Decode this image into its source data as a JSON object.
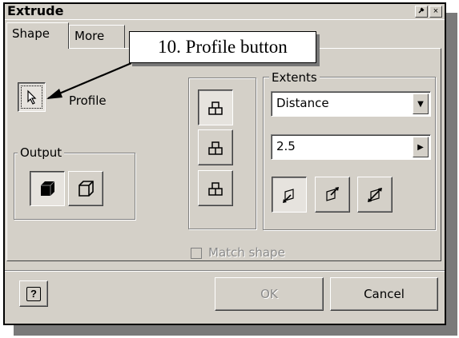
{
  "window": {
    "title": "Extrude",
    "pin_glyph": "⌐",
    "close_glyph": "×"
  },
  "tabs": [
    {
      "label": "Shape"
    },
    {
      "label": "More"
    }
  ],
  "callout": {
    "text": "10. Profile button"
  },
  "profile": {
    "label": "Profile"
  },
  "output": {
    "label": "Output"
  },
  "extents": {
    "label": "Extents",
    "type_value": "Distance",
    "distance_value": "2.5"
  },
  "match_shape": {
    "label": "Match shape",
    "checked": false,
    "enabled": false
  },
  "buttons": {
    "ok": "OK",
    "cancel": "Cancel",
    "help": "?"
  },
  "icons": {
    "profile": "select-arrow-icon",
    "solid_output": "solid-cube-icon",
    "surface_output": "surface-cube-icon",
    "operations": [
      "join-icon",
      "cut-icon",
      "intersect-icon"
    ],
    "directions": [
      "direction-1-icon",
      "direction-2-icon",
      "symmetric-icon"
    ]
  }
}
